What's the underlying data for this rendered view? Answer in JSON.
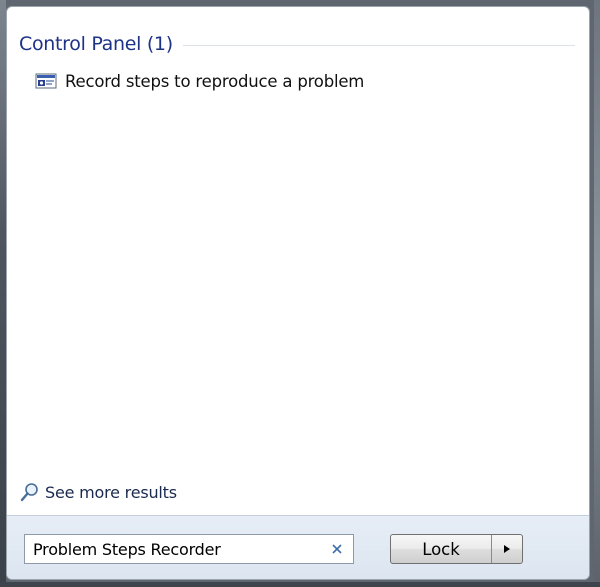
{
  "results": {
    "group_title": "Control Panel (1)",
    "items": [
      {
        "label": "Record steps to reproduce a problem",
        "icon": "problem-steps-recorder-icon"
      }
    ]
  },
  "see_more": {
    "label": "See more results",
    "icon": "search-magnifier-icon"
  },
  "search": {
    "value": "Problem Steps Recorder",
    "clear_icon": "clear-x-icon"
  },
  "power": {
    "lock_label": "Lock",
    "arrow_icon": "triangle-right-icon"
  },
  "colors": {
    "group_title": "#1e3287",
    "bottom_bar": "#dce5f0",
    "panel_background": "#ffffff"
  }
}
